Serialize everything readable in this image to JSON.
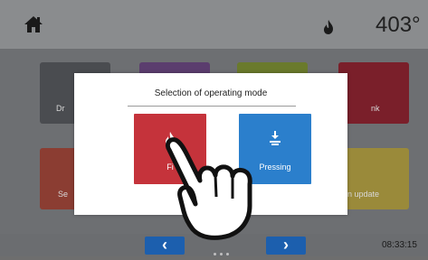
{
  "header": {
    "temperature": "403°",
    "home_icon": "home-icon",
    "flame_icon": "flame-icon"
  },
  "tiles": [
    {
      "label": "Dr",
      "color": "#4a4c50"
    },
    {
      "label": "",
      "color": "#5b3d6e"
    },
    {
      "label": "",
      "color": "#6a7a2c"
    },
    {
      "label": "nk",
      "color": "#7a1f2a"
    },
    {
      "label": "Se",
      "color": "#8b3d32"
    },
    {
      "label": "",
      "color": "#5f5f5f"
    },
    {
      "label": "",
      "color": "#5f5f5f"
    },
    {
      "label": "n update",
      "color": "#9a8a3a"
    }
  ],
  "dialog": {
    "title": "Selection of operating mode",
    "buttons": [
      {
        "label": "Fi",
        "icon": "flame-icon",
        "color": "#c5333b"
      },
      {
        "label": "Pressing",
        "icon": "press-icon",
        "color": "#2b7fcc"
      }
    ]
  },
  "footer": {
    "prev": "‹",
    "next": "›",
    "time": "08:33:15"
  }
}
